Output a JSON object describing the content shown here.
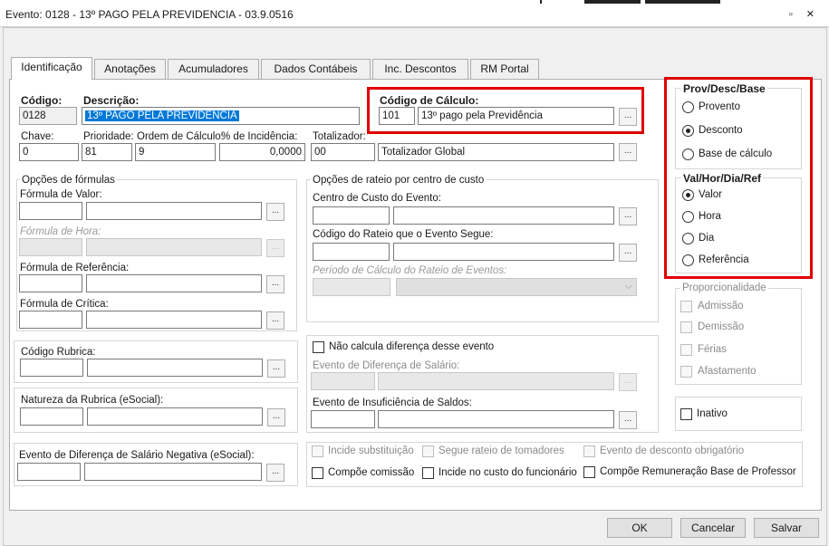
{
  "window": {
    "title": "Evento: 0128 - 13º PAGO PELA PREVIDENCIA - 03.9.0516",
    "controls": "▫ ✕"
  },
  "tabs": [
    "Identificação",
    "Anotações",
    "Acumuladores",
    "Dados Contábeis",
    "Inc. Descontos",
    "RM Portal"
  ],
  "header": {
    "codigo_label": "Código:",
    "codigo_value": "0128",
    "descricao_label": "Descrição:",
    "descricao_value": "13º PAGO PELA PREVIDENCIA",
    "codigo_calculo_label": "Código de Cálculo:",
    "codigo_calculo_value": "101",
    "codigo_calculo_desc": "13º pago pela Previdência",
    "chave_label": "Chave:",
    "chave_value": "0",
    "prioridade_label": "Prioridade:",
    "prioridade_value": "81",
    "ordem_label": "Ordem de Cálculo:",
    "ordem_value": "9",
    "incidencia_label": "% de Incidência:",
    "incidencia_value": "0,0000",
    "totalizador_label": "Totalizador:",
    "totalizador_value": "00",
    "totalizador_desc": "Totalizador Global"
  },
  "formulas": {
    "title": "Opções de fórmulas",
    "valor_label": "Fórmula de Valor:",
    "hora_label": "Fórmula de Hora:",
    "referencia_label": "Fórmula de Referência:",
    "critica_label": "Fórmula de Crítica:"
  },
  "rateio": {
    "title": "Opções de rateio por centro de custo",
    "centro_label": "Centro de Custo do Evento:",
    "codigo_rateio_label": "Código do Rateio que o Evento Segue:",
    "periodo_label": "Período de Cálculo do Rateio de Eventos:"
  },
  "rubrica": {
    "codigo_label": "Código Rubrica:",
    "natureza_label": "Natureza da Rubrica (eSocial):",
    "diferenca_neg_label": "Evento de Diferença de Salário Negativa (eSocial):"
  },
  "diferenca": {
    "nao_calcula_label": "Não calcula diferença desse evento",
    "evento_diferenca_label": "Evento de Diferença de Salário:",
    "evento_insuficiencia_label": "Evento de Insuficiência de Saldos:"
  },
  "flags": {
    "incide_substituicao": "Incide substituição",
    "segue_rateio": "Segue rateio de tomadores",
    "desconto_obrigatorio": "Evento de desconto obrigatório",
    "compoe_comissao": "Compõe comissão",
    "incide_custo": "Incide no custo do funcionário",
    "compoe_remuneracao": "Compõe Remuneração Base de Professor"
  },
  "prov_desc_base": {
    "title": "Prov/Desc/Base",
    "options": [
      "Provento",
      "Desconto",
      "Base de cálculo"
    ],
    "selected": "Desconto"
  },
  "val_hor": {
    "title": "Val/Hor/Dia/Ref",
    "options": [
      "Valor",
      "Hora",
      "Dia",
      "Referência"
    ],
    "selected": "Valor"
  },
  "proporcionalidade": {
    "title": "Proporcionalidade",
    "options": [
      "Admissão",
      "Demissão",
      "Férias",
      "Afastamento"
    ]
  },
  "inativo_label": "Inativo",
  "dots": "...",
  "footer": {
    "ok": "OK",
    "cancelar": "Cancelar",
    "salvar": "Salvar"
  },
  "colors": {
    "highlight": "#e00000",
    "selection": "#0078d7"
  }
}
